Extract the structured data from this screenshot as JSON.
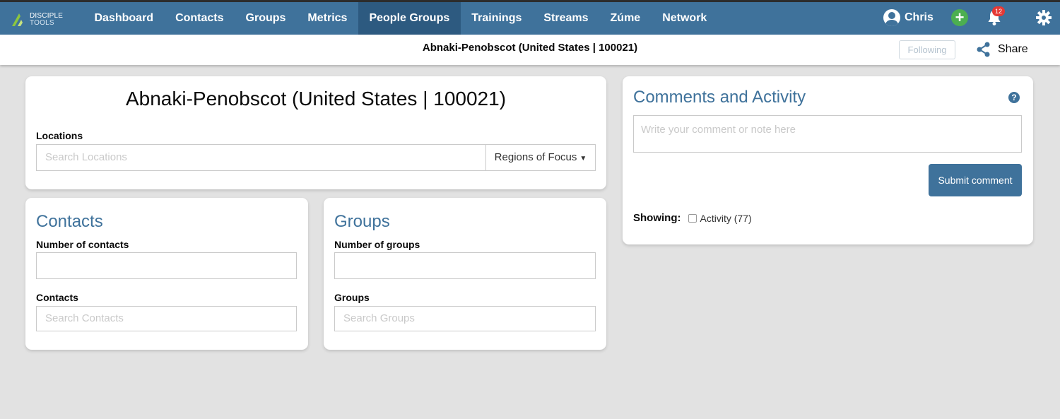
{
  "logo": {
    "line1": "DISCIPLE",
    "line2": "TOOLS"
  },
  "nav": {
    "items": [
      {
        "label": "Dashboard"
      },
      {
        "label": "Contacts"
      },
      {
        "label": "Groups"
      },
      {
        "label": "Metrics"
      },
      {
        "label": "People Groups",
        "active": true
      },
      {
        "label": "Trainings"
      },
      {
        "label": "Streams"
      },
      {
        "label": "Zúme"
      },
      {
        "label": "Network"
      }
    ],
    "user_name": "Chris",
    "add_label": "+",
    "notification_count": "12"
  },
  "subbar": {
    "record_title": "Abnaki-Penobscot (United States | 100021)",
    "following_label": "Following",
    "share_label": "Share"
  },
  "main": {
    "title": "Abnaki-Penobscot (United States | 100021)",
    "locations_label": "Locations",
    "locations_placeholder": "Search Locations",
    "regions_label": "Regions of Focus"
  },
  "contacts": {
    "title": "Contacts",
    "number_label": "Number of contacts",
    "number_value": "",
    "list_label": "Contacts",
    "search_placeholder": "Search Contacts"
  },
  "groups": {
    "title": "Groups",
    "number_label": "Number of groups",
    "number_value": "",
    "list_label": "Groups",
    "search_placeholder": "Search Groups"
  },
  "comments": {
    "title": "Comments and Activity",
    "help_label": "?",
    "placeholder": "Write your comment or note here",
    "submit_label": "Submit comment",
    "showing_label": "Showing:",
    "activity_label": "Activity (77)",
    "activity_checked": false
  },
  "colors": {
    "primary": "#3f729b",
    "nav_active": "#2d5a80",
    "add_green": "#4caf50",
    "badge_red": "#e53935",
    "page_bg": "#e2e2e2"
  },
  "icons": [
    "user-icon",
    "plus-icon",
    "bell-icon",
    "gear-icon",
    "share-icon",
    "help-icon",
    "caret-down-icon"
  ]
}
